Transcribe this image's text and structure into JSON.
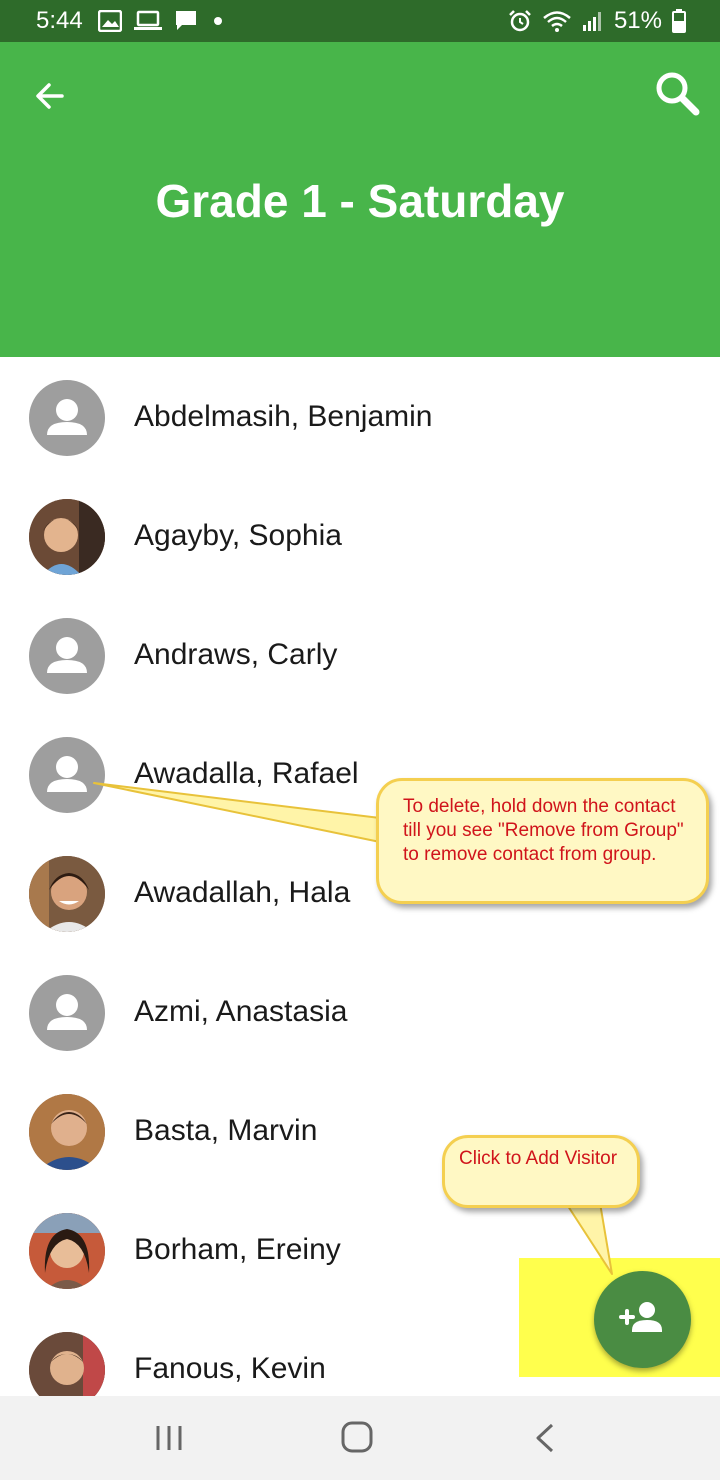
{
  "status_bar": {
    "time": "5:44",
    "battery": "51%",
    "left_icons": [
      "image-icon",
      "laptop-icon",
      "chat-icon",
      "notification-dot"
    ],
    "right_icons": [
      "alarm-icon",
      "wifi-icon",
      "signal-icon",
      "battery-icon"
    ]
  },
  "app_bar": {
    "title": "Grade 1 - Saturday",
    "back_icon": "arrow-left-icon",
    "search_icon": "search-icon",
    "color": "#48b54a"
  },
  "contacts": [
    {
      "name": "Abdelmasih, Benjamin",
      "avatar": "placeholder"
    },
    {
      "name": "Agayby, Sophia",
      "avatar": "photo"
    },
    {
      "name": "Andraws, Carly",
      "avatar": "placeholder"
    },
    {
      "name": "Awadalla, Rafael",
      "avatar": "placeholder"
    },
    {
      "name": "Awadallah, Hala",
      "avatar": "photo"
    },
    {
      "name": "Azmi, Anastasia",
      "avatar": "placeholder"
    },
    {
      "name": "Basta, Marvin",
      "avatar": "photo"
    },
    {
      "name": "Borham, Ereiny",
      "avatar": "photo"
    },
    {
      "name": "Fanous, Kevin",
      "avatar": "photo"
    }
  ],
  "callouts": {
    "delete_text": "To delete, hold down the contact till you see \"Remove from Group\" to remove contact from group.",
    "add_text": "Click to Add Visitor"
  },
  "fab": {
    "icon": "add-person-icon",
    "color": "#4a8c43"
  },
  "highlight_color": "#ffff4d",
  "nav_bar": {
    "icons": [
      "recents-icon",
      "home-icon",
      "back-icon"
    ]
  }
}
